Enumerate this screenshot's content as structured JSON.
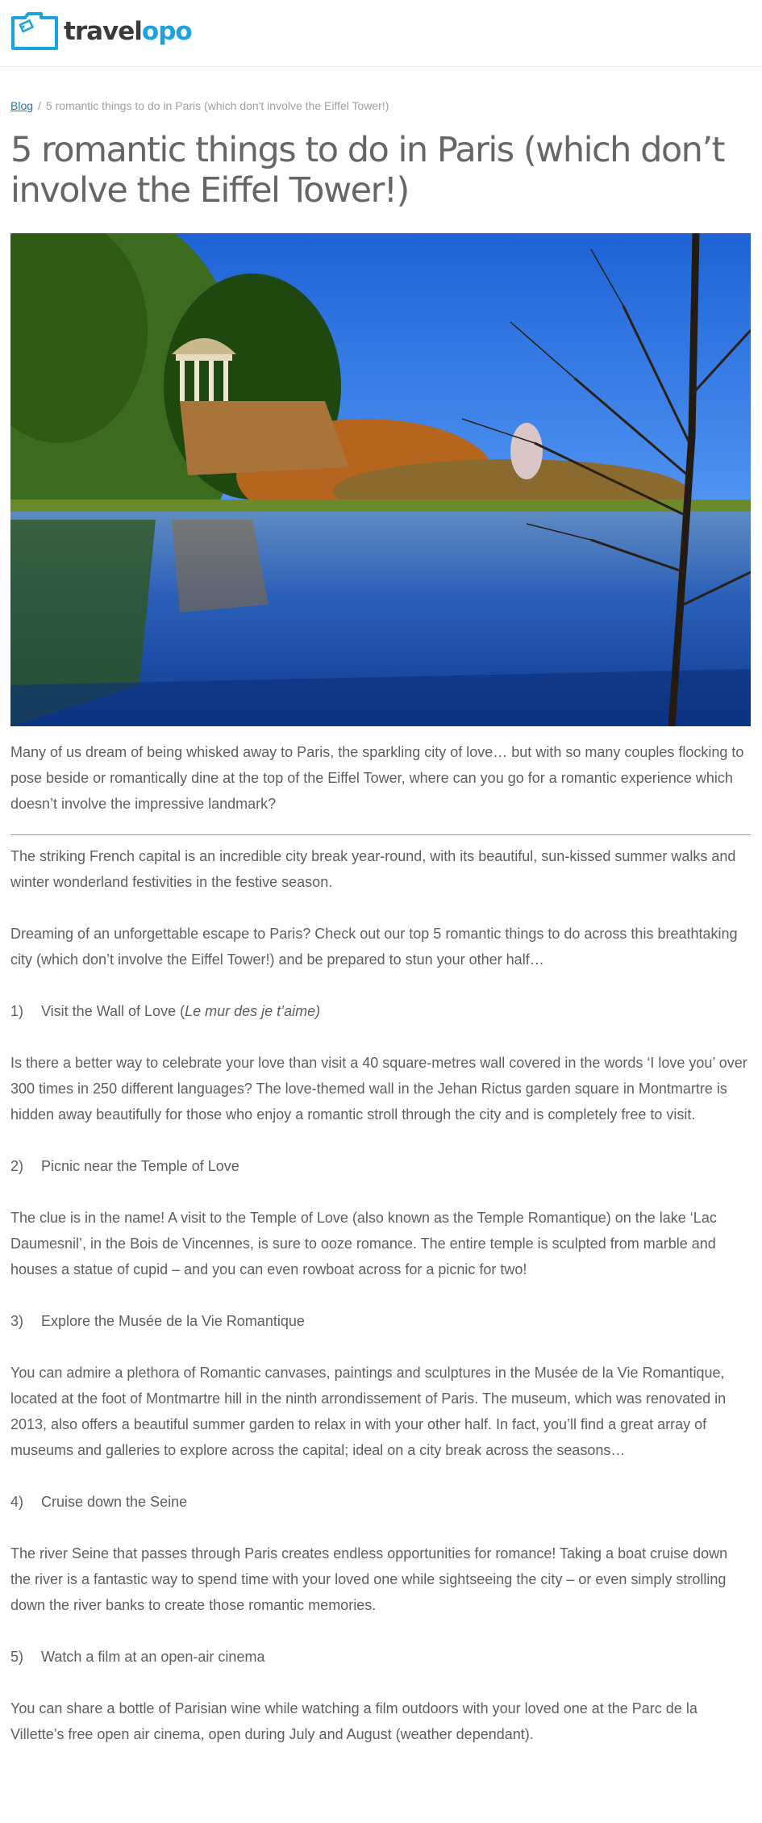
{
  "brand": {
    "part1": "travel",
    "part2": "opo",
    "accent": "#1aa3e0",
    "icon": "folder-tag-icon"
  },
  "breadcrumb": {
    "link": "Blog",
    "separator": "/",
    "current": "5 romantic things to do in Paris (which don't involve the Eiffel Tower!)"
  },
  "title": "5 romantic things to do in Paris (which don’t involve the Eiffel Tower!)",
  "hero": {
    "icon": "temple-lake-photo"
  },
  "intro": "Many of us dream of being whisked away to Paris, the sparkling city of love… but with so many couples flocking to pose beside or romantically dine at the top of the Eiffel Tower, where can you go for a romantic experience which doesn’t involve the impressive landmark?",
  "para1": "The striking French capital is an incredible city break year-round, with its beautiful, sun-kissed summer walks and winter wonderland festivities in the festive season.",
  "para2": "Dreaming of an unforgettable escape to Paris? Check out our top 5 romantic things to do across this breathtaking city (which don’t involve the Eiffel Tower!) and be prepared to stun your other half…",
  "items": [
    {
      "num": "1)",
      "title": "Visit the Wall of Love (",
      "title_italic": "Le mur des je t’aime)",
      "body": "Is there a better way to celebrate your love than visit a 40 square-metres wall covered in the words ‘I love you’ over 300 times in 250 different languages? The love-themed wall in the Jehan Rictus garden square in Montmartre is hidden away beautifully for those who enjoy a romantic stroll through the city and is completely free to visit."
    },
    {
      "num": "2)",
      "title": "Picnic near the Temple of Love",
      "body": "The clue is in the name! A visit to the Temple of Love (also known as the Temple Romantique) on the lake ‘Lac Daumesnil’, in the Bois de Vincennes, is sure to ooze romance. The entire temple is sculpted from marble and houses a statue of cupid – and you can even rowboat across for a picnic for two!"
    },
    {
      "num": "3)",
      "title": "Explore the Musée de la Vie Romantique",
      "body": "You can admire a plethora of Romantic canvases, paintings and sculptures in the Musée de la Vie Romantique, located at the foot of Montmartre hill in the ninth arrondissement of Paris. The museum, which was renovated in 2013, also offers a beautiful summer garden to relax in with your other half. In fact, you’ll find a great array of museums and galleries to explore across the capital; ideal on a city break across the seasons…"
    },
    {
      "num": "4)",
      "title": "Cruise down the Seine",
      "body": "The river Seine that passes through Paris creates endless opportunities for romance! Taking a boat cruise down the river is a fantastic way to spend time with your loved one while sightseeing the city – or even simply strolling down the river banks to create those romantic memories."
    },
    {
      "num": "5)",
      "title": "Watch a film at an open-air cinema",
      "body": "You can share a bottle of Parisian wine while watching a film outdoors with your loved one at the Parc de la Villette’s free open air cinema, open during July and August (weather dependant)."
    }
  ]
}
